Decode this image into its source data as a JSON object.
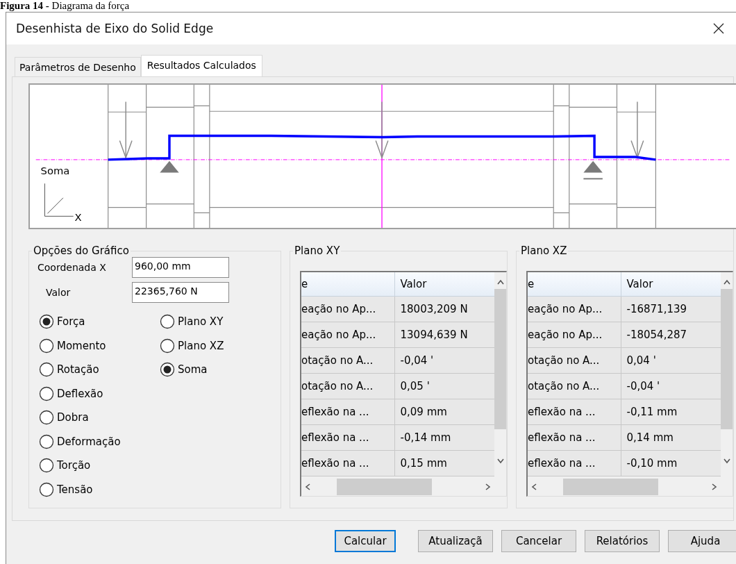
{
  "caption": "**Figura 14 -** Diagrama da força",
  "window": {
    "title": "Desenhista de Eixo do Solid Edge"
  },
  "tabs": [
    {
      "label": "Parâmetros de Desenho",
      "selected": false
    },
    {
      "label": "Resultados Calculados",
      "selected": true
    }
  ],
  "diagram": {
    "label": "Soma",
    "axis_label": "X"
  },
  "options": {
    "title": "Opções do Gráfico",
    "fields": [
      {
        "label": "Coordenada X",
        "value": "960,00 mm"
      },
      {
        "label": "Valor",
        "value": "22365,760 N"
      }
    ],
    "quantity_radios": [
      {
        "label": "Força",
        "selected": true
      },
      {
        "label": "Momento",
        "selected": false
      },
      {
        "label": "Rotação",
        "selected": false
      },
      {
        "label": "Deflexão",
        "selected": false
      },
      {
        "label": "Dobra",
        "selected": false
      },
      {
        "label": "Deformação",
        "selected": false
      },
      {
        "label": "Torção",
        "selected": false
      },
      {
        "label": "Tensão",
        "selected": false
      }
    ],
    "plane_radios": [
      {
        "label": "Plano XY",
        "selected": false
      },
      {
        "label": "Plano XZ",
        "selected": false
      },
      {
        "label": "Soma",
        "selected": true
      }
    ]
  },
  "tables": [
    {
      "title": "Plano XY",
      "columns": [
        "e",
        "Valor"
      ],
      "rows": [
        [
          "eação no Ap...",
          "18003,209 N"
        ],
        [
          "eação no Ap...",
          "13094,639 N"
        ],
        [
          "otação no A...",
          "-0,04 '"
        ],
        [
          "otação no A...",
          "0,05 '"
        ],
        [
          "eflexão na ...",
          "0,09 mm"
        ],
        [
          "eflexão na ...",
          "-0,14 mm"
        ],
        [
          "eflexão na ...",
          "0,15 mm"
        ]
      ]
    },
    {
      "title": "Plano XZ",
      "columns": [
        "e",
        "Valor"
      ],
      "rows": [
        [
          "eação no Ap...",
          "-16871,139"
        ],
        [
          "eação no Ap...",
          "-18054,287"
        ],
        [
          "otação no A...",
          "0,04 '"
        ],
        [
          "otação no A...",
          "-0,04 '"
        ],
        [
          "eflexão na ...",
          "-0,11 mm"
        ],
        [
          "eflexão na ...",
          "0,14 mm"
        ],
        [
          "eflexão na ...",
          "-0,10 mm"
        ]
      ]
    }
  ],
  "buttons": [
    {
      "label": "Calcular",
      "kind": "default"
    },
    {
      "label": "Atualizaçã",
      "kind": "normal"
    },
    {
      "label": "Cancelar",
      "kind": "normal"
    },
    {
      "label": "Relatórios",
      "kind": "normal"
    },
    {
      "label": "Ajuda",
      "kind": "normal"
    }
  ]
}
